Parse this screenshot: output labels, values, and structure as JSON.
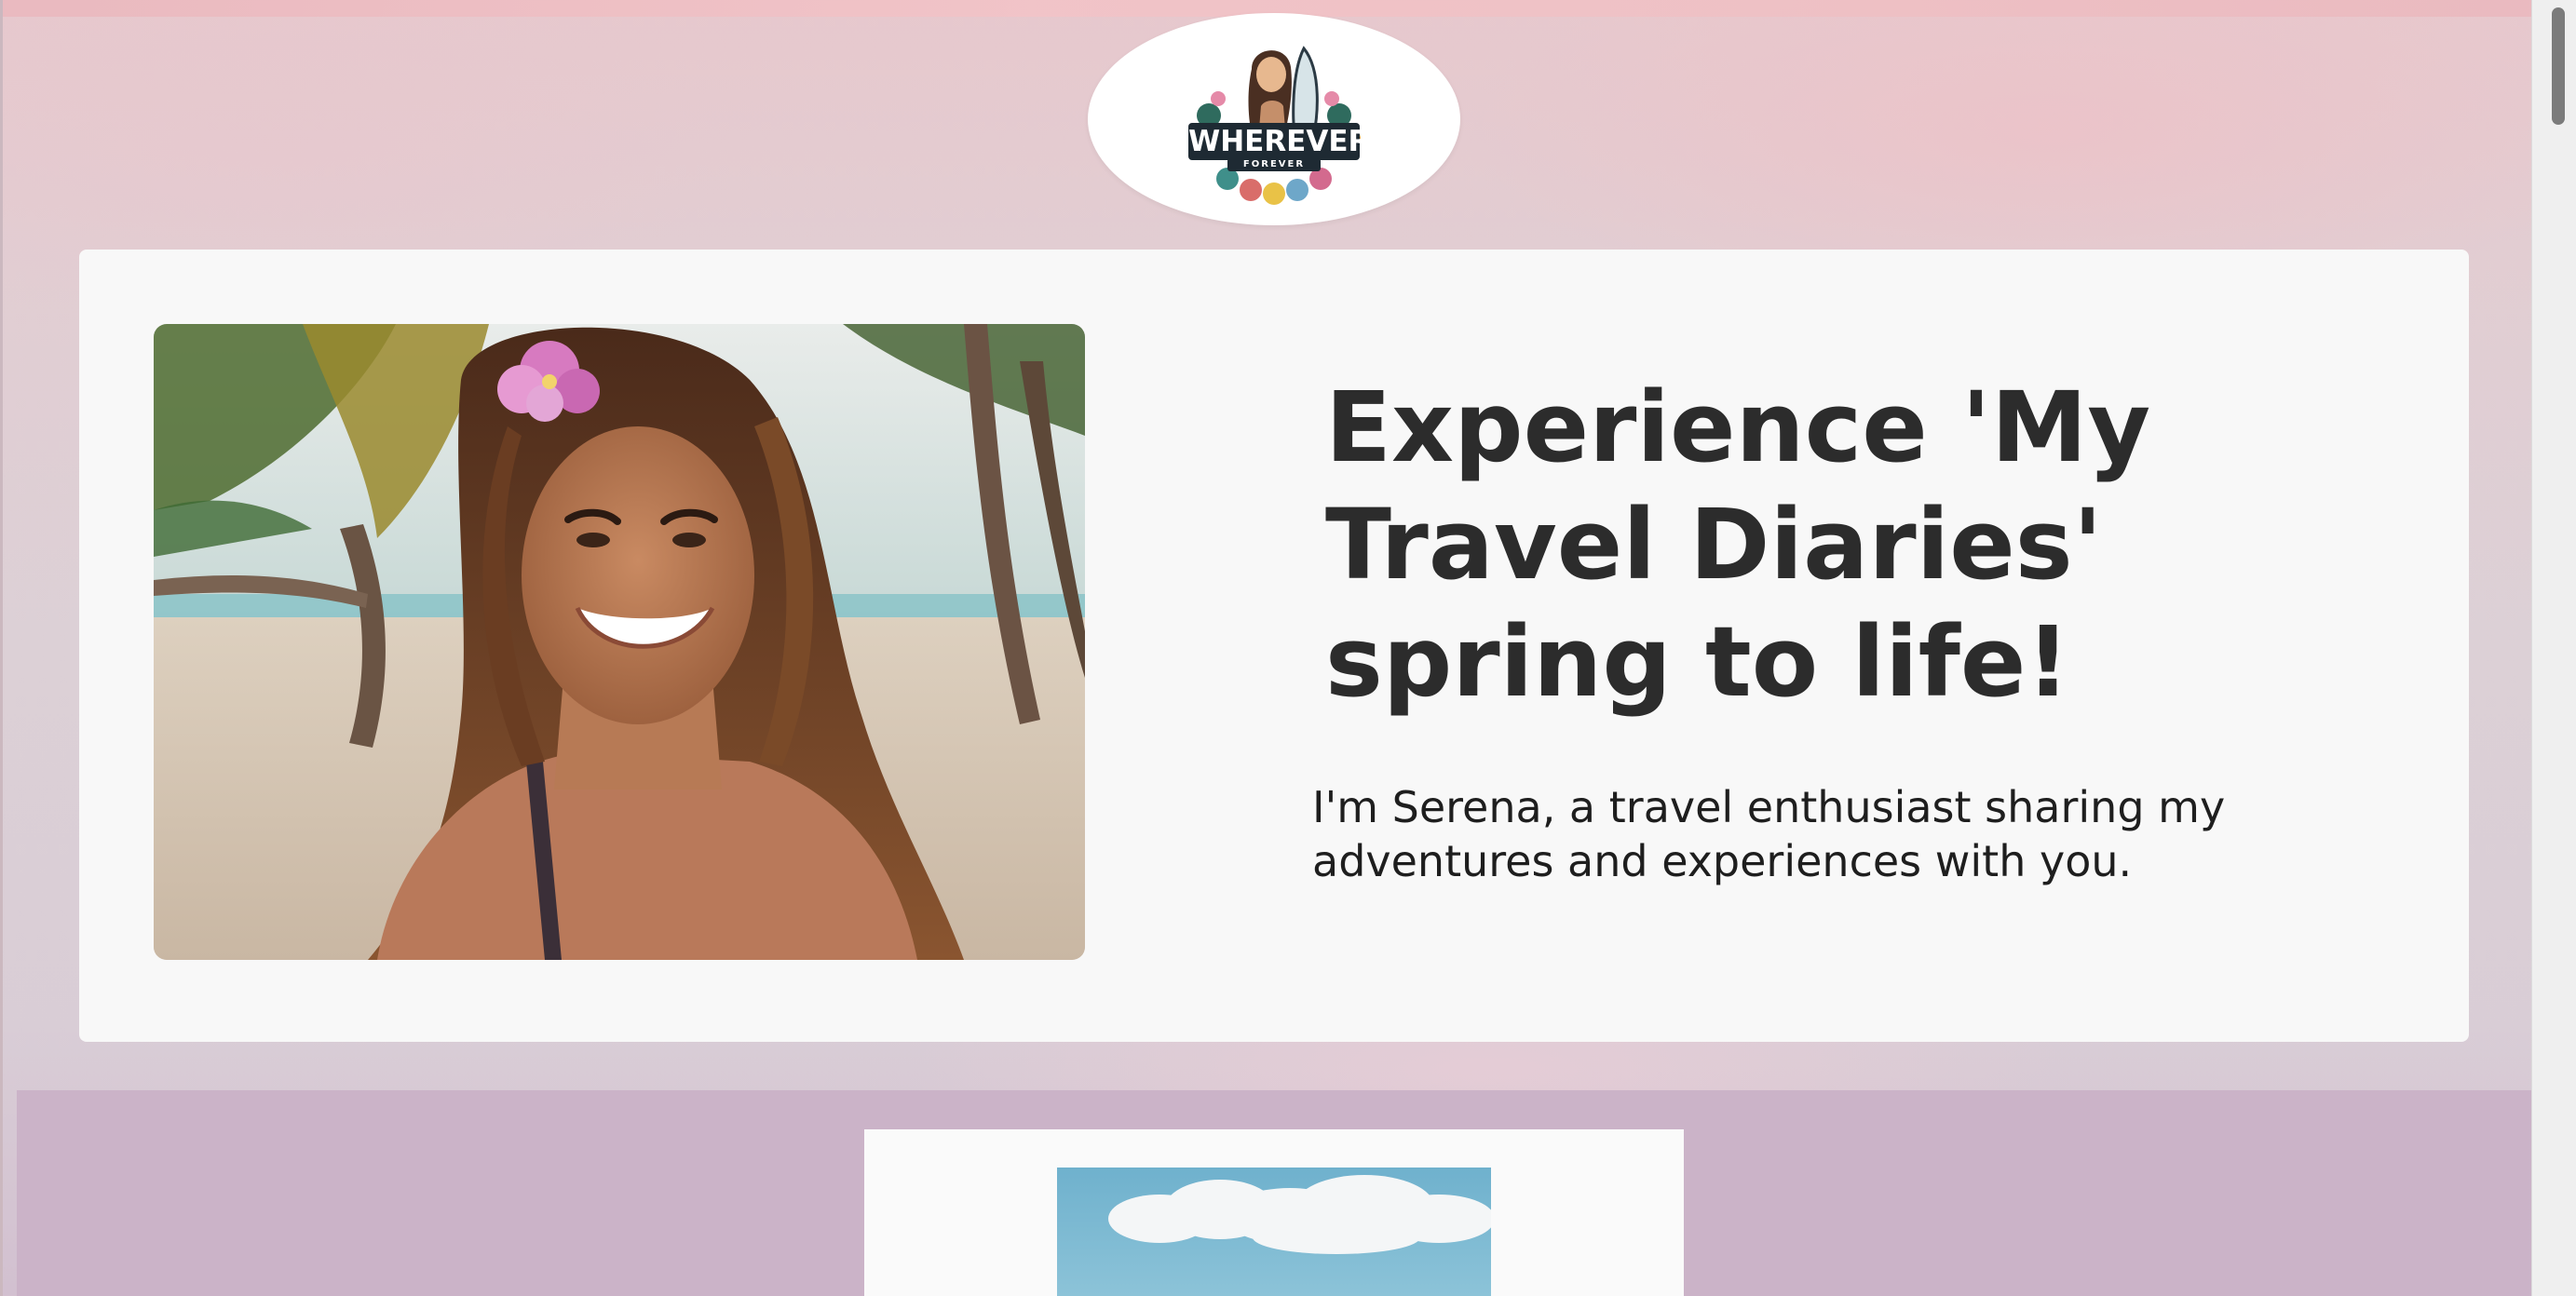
{
  "logo": {
    "brand_name": "WHEREVER",
    "tagline": "FOREVER"
  },
  "hero": {
    "title": "Experience 'My Travel Diaries' spring to life!",
    "subtitle": "I'm Serena, a travel enthusiast sharing my adventures and experiences with you."
  },
  "colors": {
    "page_background": "#dcd0d6",
    "card_background": "#f8f8f8",
    "heading_text": "#2c2c2c",
    "band_background": "#cbb3c8"
  }
}
